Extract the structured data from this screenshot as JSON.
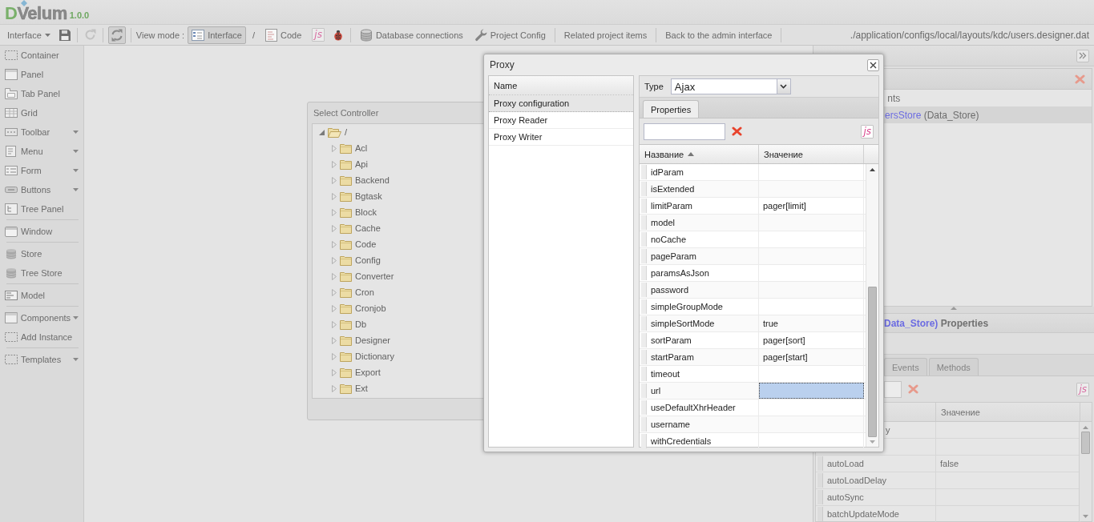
{
  "header": {
    "logo": {
      "initial": "D",
      "rest": "Velum"
    },
    "version": "1.0.0"
  },
  "toolbar": {
    "menu_label": "Interface",
    "refresh_button": {
      "disabled": true
    },
    "sync_button": {
      "pressed": true
    },
    "view_mode_label": "View mode :",
    "view_modes": [
      {
        "label": "Interface",
        "selected": true
      },
      {
        "label": "Code",
        "selected": false
      }
    ],
    "mode_divider": "/",
    "script_button": "js",
    "links": [
      "Database connections",
      "Project Config",
      "Related project items",
      "Back to the admin interface"
    ],
    "path": "./application/configs/local/layouts/kdc/users.designer.dat"
  },
  "sidebar": {
    "groups": [
      [
        {
          "label": "Container",
          "kind": "container",
          "menu": false
        },
        {
          "label": "Panel",
          "kind": "panel",
          "menu": false
        },
        {
          "label": "Tab Panel",
          "kind": "tabs",
          "menu": false
        },
        {
          "label": "Grid",
          "kind": "grid",
          "menu": false
        },
        {
          "label": "Toolbar",
          "kind": "toolbar",
          "menu": true
        },
        {
          "label": "Menu",
          "kind": "menu",
          "menu": true
        },
        {
          "label": "Form",
          "kind": "form",
          "menu": true
        },
        {
          "label": "Buttons",
          "kind": "button",
          "menu": true
        },
        {
          "label": "Tree Panel",
          "kind": "tree",
          "menu": false
        }
      ],
      [
        {
          "label": "Window",
          "kind": "window",
          "menu": false
        }
      ],
      [
        {
          "label": "Store",
          "kind": "store",
          "menu": false
        },
        {
          "label": "Tree Store",
          "kind": "store",
          "menu": false
        }
      ],
      [
        {
          "label": "Model",
          "kind": "model",
          "menu": false
        }
      ],
      [
        {
          "label": "Components",
          "kind": "panel",
          "menu": true
        },
        {
          "label": "Add Instance",
          "kind": "container",
          "menu": false
        }
      ],
      [
        {
          "label": "Templates",
          "kind": "container",
          "menu": true
        }
      ]
    ]
  },
  "controller_window": {
    "title": "Select Controller",
    "tree": [
      {
        "label": "/",
        "expanded": true,
        "children": [
          {
            "label": "Acl",
            "expanded": false
          },
          {
            "label": "Api",
            "expanded": false
          },
          {
            "label": "Backend",
            "expanded": false
          },
          {
            "label": "Bgtask",
            "expanded": false
          },
          {
            "label": "Block",
            "expanded": false
          },
          {
            "label": "Cache",
            "expanded": false
          },
          {
            "label": "Code",
            "expanded": false
          },
          {
            "label": "Config",
            "expanded": false
          },
          {
            "label": "Converter",
            "expanded": false
          },
          {
            "label": "Cron",
            "expanded": false
          },
          {
            "label": "Cronjob",
            "expanded": false
          },
          {
            "label": "Db",
            "expanded": false
          },
          {
            "label": "Designer",
            "expanded": false
          },
          {
            "label": "Dictionary",
            "expanded": false
          },
          {
            "label": "Export",
            "expanded": false
          },
          {
            "label": "Ext",
            "expanded": false
          }
        ]
      }
    ]
  },
  "proxy_window": {
    "title": "Proxy",
    "list_header": "Name",
    "sections": [
      {
        "label": "Proxy configuration",
        "selected": true
      },
      {
        "label": "Proxy Reader",
        "selected": false
      },
      {
        "label": "Proxy Writer",
        "selected": false
      }
    ],
    "type_label": "Type",
    "type_value": "Ajax",
    "tabs": [
      {
        "label": "Properties",
        "selected": true
      }
    ],
    "script_button": "js",
    "columns": [
      {
        "label": "Название",
        "sorted_ascending": true
      },
      {
        "label": "Значение",
        "sorted_ascending": false
      }
    ],
    "rows": [
      {
        "name": "idParam",
        "selected": false
      },
      {
        "name": "isExtended",
        "selected": false
      },
      {
        "name": "limitParam",
        "value": "pager[limit]",
        "selected": false
      },
      {
        "name": "model",
        "selected": false
      },
      {
        "name": "noCache",
        "selected": false
      },
      {
        "name": "pageParam",
        "selected": false
      },
      {
        "name": "paramsAsJson",
        "selected": false
      },
      {
        "name": "password",
        "selected": false
      },
      {
        "name": "simpleGroupMode",
        "selected": false
      },
      {
        "name": "simpleSortMode",
        "value": "true",
        "selected": false
      },
      {
        "name": "sortParam",
        "value": "pager[sort]",
        "selected": false
      },
      {
        "name": "startParam",
        "value": "pager[start]",
        "selected": false
      },
      {
        "name": "timeout",
        "selected": false
      },
      {
        "name": "url",
        "selected": true
      },
      {
        "name": "useDefaultXhrHeader",
        "selected": false
      },
      {
        "name": "username",
        "selected": false
      },
      {
        "name": "withCredentials",
        "selected": false
      }
    ]
  },
  "right_panel": {
    "tree": [
      {
        "label": "nts",
        "selected": false
      },
      {
        "name": "ersStore",
        "label": "(Data_Store)",
        "selected": true
      }
    ],
    "properties_title": {
      "object": "Data_Store)",
      "label": "Properties"
    },
    "tabs": [
      {
        "label": "Events",
        "selected": false
      },
      {
        "label": "Methods",
        "selected": false
      }
    ],
    "script_button": "js",
    "columns": [
      {
        "label": "Значение"
      }
    ],
    "rows": [
      {
        "name": "y"
      },
      {},
      {
        "name": "autoLoad",
        "value": "false"
      },
      {
        "name": "autoLoadDelay"
      },
      {
        "name": "autoSync"
      },
      {
        "name": "batchUpdateMode"
      }
    ]
  }
}
